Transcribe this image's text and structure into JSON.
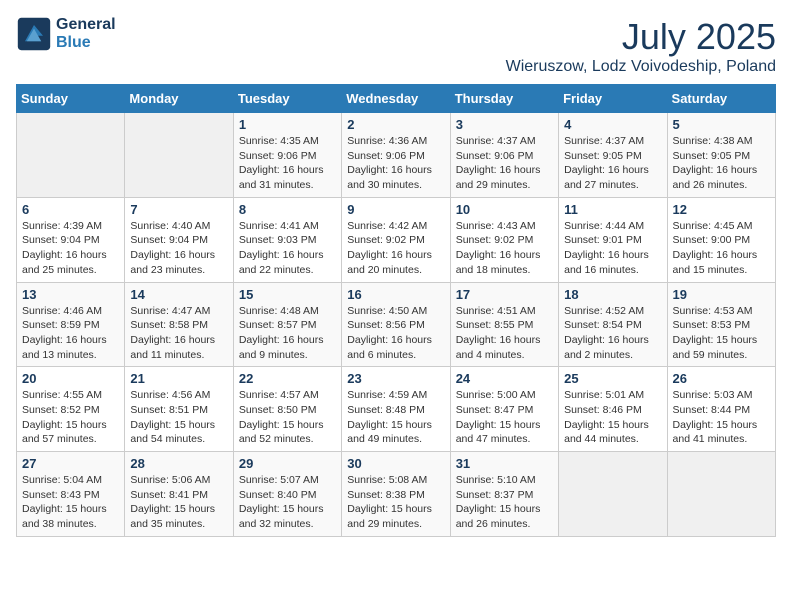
{
  "header": {
    "logo_line1": "General",
    "logo_line2": "Blue",
    "month": "July 2025",
    "location": "Wieruszow, Lodz Voivodeship, Poland"
  },
  "weekdays": [
    "Sunday",
    "Monday",
    "Tuesday",
    "Wednesday",
    "Thursday",
    "Friday",
    "Saturday"
  ],
  "weeks": [
    [
      {
        "day": "",
        "info": ""
      },
      {
        "day": "",
        "info": ""
      },
      {
        "day": "1",
        "info": "Sunrise: 4:35 AM\nSunset: 9:06 PM\nDaylight: 16 hours and 31 minutes."
      },
      {
        "day": "2",
        "info": "Sunrise: 4:36 AM\nSunset: 9:06 PM\nDaylight: 16 hours and 30 minutes."
      },
      {
        "day": "3",
        "info": "Sunrise: 4:37 AM\nSunset: 9:06 PM\nDaylight: 16 hours and 29 minutes."
      },
      {
        "day": "4",
        "info": "Sunrise: 4:37 AM\nSunset: 9:05 PM\nDaylight: 16 hours and 27 minutes."
      },
      {
        "day": "5",
        "info": "Sunrise: 4:38 AM\nSunset: 9:05 PM\nDaylight: 16 hours and 26 minutes."
      }
    ],
    [
      {
        "day": "6",
        "info": "Sunrise: 4:39 AM\nSunset: 9:04 PM\nDaylight: 16 hours and 25 minutes."
      },
      {
        "day": "7",
        "info": "Sunrise: 4:40 AM\nSunset: 9:04 PM\nDaylight: 16 hours and 23 minutes."
      },
      {
        "day": "8",
        "info": "Sunrise: 4:41 AM\nSunset: 9:03 PM\nDaylight: 16 hours and 22 minutes."
      },
      {
        "day": "9",
        "info": "Sunrise: 4:42 AM\nSunset: 9:02 PM\nDaylight: 16 hours and 20 minutes."
      },
      {
        "day": "10",
        "info": "Sunrise: 4:43 AM\nSunset: 9:02 PM\nDaylight: 16 hours and 18 minutes."
      },
      {
        "day": "11",
        "info": "Sunrise: 4:44 AM\nSunset: 9:01 PM\nDaylight: 16 hours and 16 minutes."
      },
      {
        "day": "12",
        "info": "Sunrise: 4:45 AM\nSunset: 9:00 PM\nDaylight: 16 hours and 15 minutes."
      }
    ],
    [
      {
        "day": "13",
        "info": "Sunrise: 4:46 AM\nSunset: 8:59 PM\nDaylight: 16 hours and 13 minutes."
      },
      {
        "day": "14",
        "info": "Sunrise: 4:47 AM\nSunset: 8:58 PM\nDaylight: 16 hours and 11 minutes."
      },
      {
        "day": "15",
        "info": "Sunrise: 4:48 AM\nSunset: 8:57 PM\nDaylight: 16 hours and 9 minutes."
      },
      {
        "day": "16",
        "info": "Sunrise: 4:50 AM\nSunset: 8:56 PM\nDaylight: 16 hours and 6 minutes."
      },
      {
        "day": "17",
        "info": "Sunrise: 4:51 AM\nSunset: 8:55 PM\nDaylight: 16 hours and 4 minutes."
      },
      {
        "day": "18",
        "info": "Sunrise: 4:52 AM\nSunset: 8:54 PM\nDaylight: 16 hours and 2 minutes."
      },
      {
        "day": "19",
        "info": "Sunrise: 4:53 AM\nSunset: 8:53 PM\nDaylight: 15 hours and 59 minutes."
      }
    ],
    [
      {
        "day": "20",
        "info": "Sunrise: 4:55 AM\nSunset: 8:52 PM\nDaylight: 15 hours and 57 minutes."
      },
      {
        "day": "21",
        "info": "Sunrise: 4:56 AM\nSunset: 8:51 PM\nDaylight: 15 hours and 54 minutes."
      },
      {
        "day": "22",
        "info": "Sunrise: 4:57 AM\nSunset: 8:50 PM\nDaylight: 15 hours and 52 minutes."
      },
      {
        "day": "23",
        "info": "Sunrise: 4:59 AM\nSunset: 8:48 PM\nDaylight: 15 hours and 49 minutes."
      },
      {
        "day": "24",
        "info": "Sunrise: 5:00 AM\nSunset: 8:47 PM\nDaylight: 15 hours and 47 minutes."
      },
      {
        "day": "25",
        "info": "Sunrise: 5:01 AM\nSunset: 8:46 PM\nDaylight: 15 hours and 44 minutes."
      },
      {
        "day": "26",
        "info": "Sunrise: 5:03 AM\nSunset: 8:44 PM\nDaylight: 15 hours and 41 minutes."
      }
    ],
    [
      {
        "day": "27",
        "info": "Sunrise: 5:04 AM\nSunset: 8:43 PM\nDaylight: 15 hours and 38 minutes."
      },
      {
        "day": "28",
        "info": "Sunrise: 5:06 AM\nSunset: 8:41 PM\nDaylight: 15 hours and 35 minutes."
      },
      {
        "day": "29",
        "info": "Sunrise: 5:07 AM\nSunset: 8:40 PM\nDaylight: 15 hours and 32 minutes."
      },
      {
        "day": "30",
        "info": "Sunrise: 5:08 AM\nSunset: 8:38 PM\nDaylight: 15 hours and 29 minutes."
      },
      {
        "day": "31",
        "info": "Sunrise: 5:10 AM\nSunset: 8:37 PM\nDaylight: 15 hours and 26 minutes."
      },
      {
        "day": "",
        "info": ""
      },
      {
        "day": "",
        "info": ""
      }
    ]
  ]
}
